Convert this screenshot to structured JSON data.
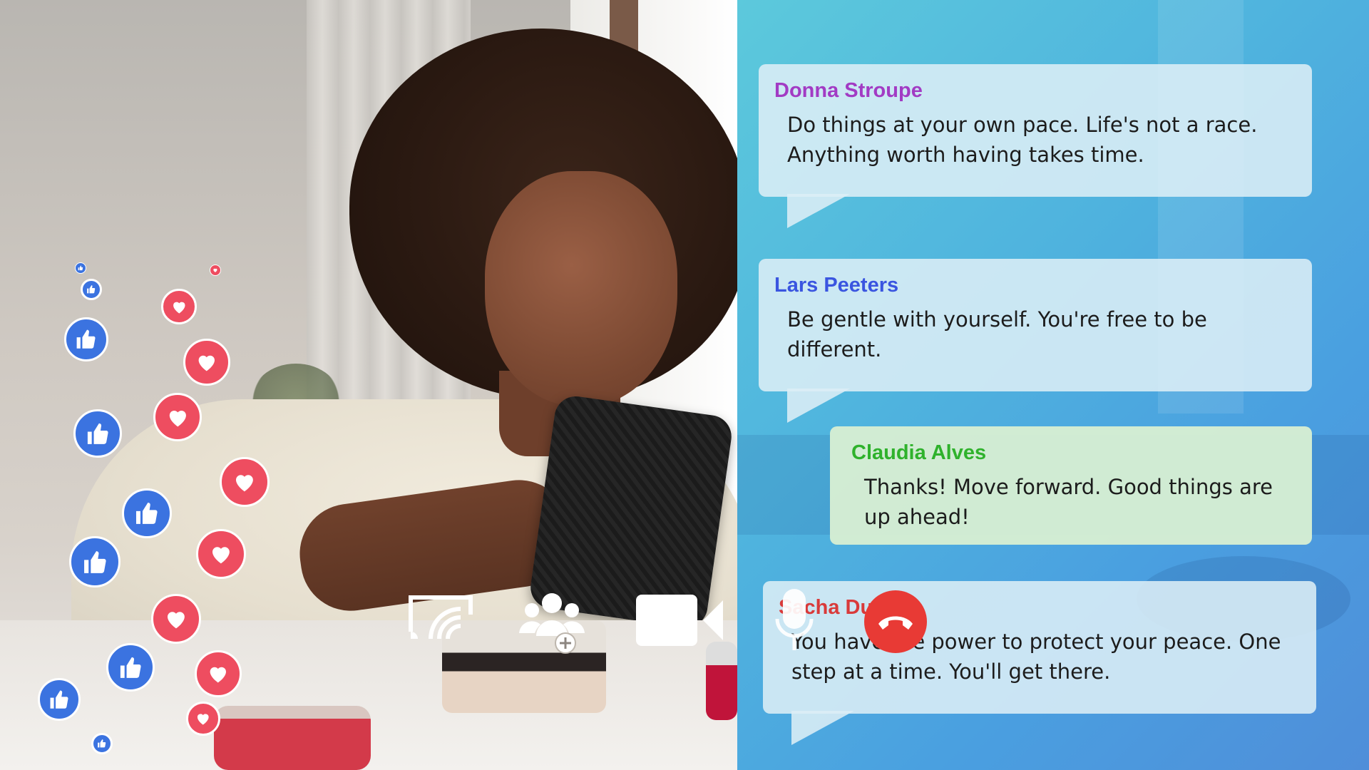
{
  "colors": {
    "chat_background": "#4fb3de",
    "bubble_background": "#dceef6",
    "bubble_highlight_background": "#d6eed2",
    "like_color": "#3b73e0",
    "heart_color": "#ee4d60",
    "end_call_color": "#e83a35"
  },
  "chat": {
    "messages": [
      {
        "author": "Donna Stroupe",
        "author_color": "#a23bc4",
        "text": "Do things at your own pace. Life's not a race. Anything worth having takes time."
      },
      {
        "author": "Lars Peeters",
        "author_color": "#3a55e0",
        "text": "Be gentle with yourself. You're free to be different."
      },
      {
        "author": "Claudia Alves",
        "author_color": "#2fb22c",
        "text": "Thanks! Move forward. Good things are up ahead!"
      },
      {
        "author": "Sacha Dubois",
        "author_color": "#d93a3a",
        "text": "You have the power to protect your peace. One step at a time. You'll get there."
      }
    ]
  },
  "call_controls": {
    "screen_cast": "cast-screen-icon",
    "add_participants": "add-people-icon",
    "video": "video-camera-icon",
    "microphone": "microphone-icon",
    "end_call": "hang-up-icon"
  },
  "reactions": [
    "like",
    "like",
    "heart",
    "like",
    "heart",
    "heart",
    "like",
    "heart",
    "like",
    "heart",
    "like",
    "heart",
    "like",
    "heart",
    "like",
    "heart",
    "like",
    "heart"
  ]
}
